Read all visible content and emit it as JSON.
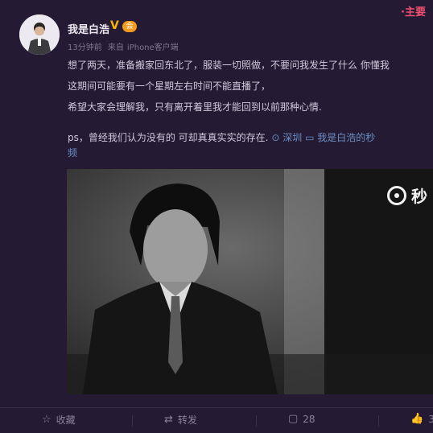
{
  "corner": {
    "tag": "·主要"
  },
  "post": {
    "username": "我是白浩",
    "verified_mark": "V",
    "vip_badge": "会",
    "time": "13分钟前",
    "source_prefix": "来自",
    "source": "iPhone客户端",
    "lines": [
      "想了两天，准备搬家回东北了，服装一切照做，不要问我发生了什么 你懂我",
      "这期间可能要有一个星期左右时间不能直播了，",
      "希望大家会理解我，只有离开着里我才能回到以前那种心情."
    ],
    "ps_text": "ps，曾经我们认为没有的 可却真真实实的存在.",
    "location": "深圳",
    "video_link": "我是白浩的秒",
    "video_link_cont": "频",
    "video_watermark": "秒"
  },
  "actions": {
    "favorite": "收藏",
    "repost": "转发",
    "comments": "28",
    "likes": "3"
  },
  "icons": [
    "location-pin-icon",
    "video-icon",
    "star-icon",
    "repost-icon",
    "comment-icon",
    "like-icon"
  ]
}
